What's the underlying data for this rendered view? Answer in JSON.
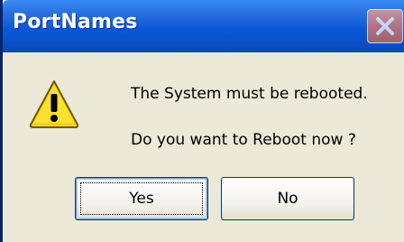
{
  "window": {
    "title": "PortNames"
  },
  "message": {
    "line1": "The System must be rebooted.",
    "line2": "Do you want to Reboot now ?"
  },
  "buttons": {
    "yes": "Yes",
    "no": "No"
  },
  "icons": {
    "warning": "warning-icon",
    "close": "close-icon"
  },
  "colors": {
    "titlebar": "#0b58d8",
    "dialog_bg": "#ece9d8",
    "warning_yellow": "#f5d40a"
  }
}
